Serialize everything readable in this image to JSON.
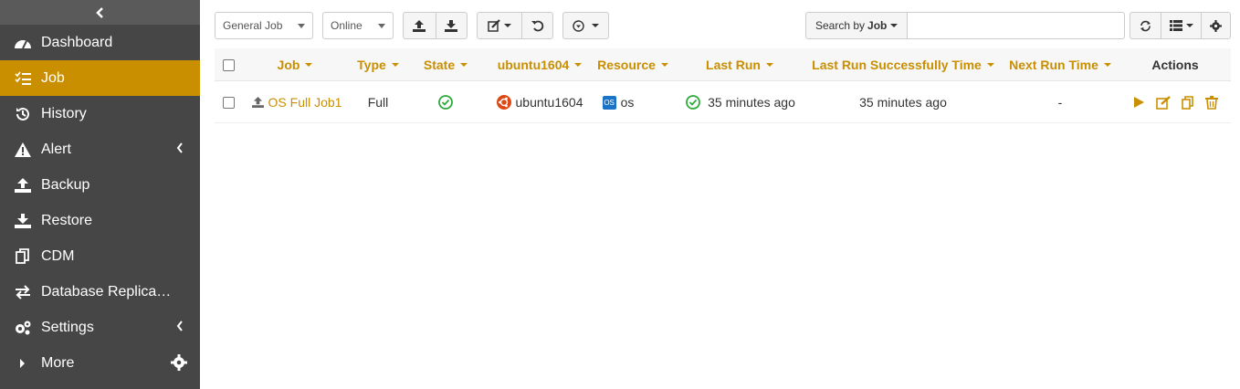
{
  "sidebar": {
    "items": [
      {
        "label": "Dashboard",
        "icon": "dashboard-icon"
      },
      {
        "label": "Job",
        "icon": "list-icon",
        "active": true
      },
      {
        "label": "History",
        "icon": "history-icon"
      },
      {
        "label": "Alert",
        "icon": "warning-icon"
      },
      {
        "label": "Backup",
        "icon": "upload-icon"
      },
      {
        "label": "Restore",
        "icon": "download-icon"
      },
      {
        "label": "CDM",
        "icon": "copy-icon"
      },
      {
        "label": "Database Replica…",
        "icon": "exchange-icon"
      },
      {
        "label": "Settings",
        "icon": "gears-icon"
      },
      {
        "label": "More",
        "icon": "caret-right-icon"
      }
    ]
  },
  "toolbar": {
    "job_type_select": "General Job",
    "status_select": "Online",
    "search_by_label": "Search by",
    "search_by_field": "Job",
    "search_value": ""
  },
  "table": {
    "columns": [
      "Job",
      "Type",
      "State",
      "ubuntu1604",
      "Resource",
      "Last Run",
      "Last Run Successfully Time",
      "Next Run Time",
      "Actions"
    ],
    "rows": [
      {
        "job": "OS Full Job1",
        "type": "Full",
        "state": "ok",
        "host": "ubuntu1604",
        "resource_badge": "OS",
        "resource": "os",
        "last_run": "35 minutes ago",
        "last_success": "35 minutes ago",
        "next_run": "-"
      }
    ]
  },
  "colors": {
    "accent": "#c98f00",
    "sidebar_bg": "#464646",
    "success": "#2eaa3c",
    "ubuntu": "#dd4814",
    "os_badge": "#1a73c7"
  }
}
